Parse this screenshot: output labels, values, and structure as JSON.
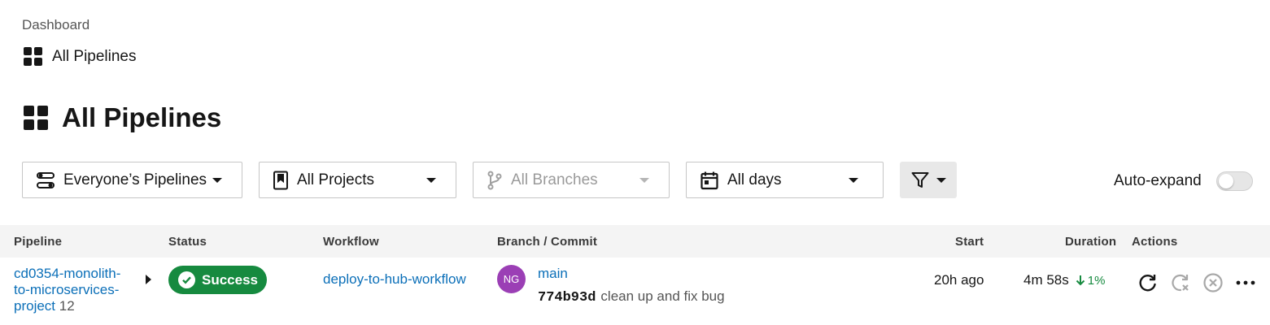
{
  "breadcrumb": {
    "parent": "Dashboard",
    "current": "All Pipelines"
  },
  "page": {
    "title": "All Pipelines"
  },
  "filters": {
    "pipelines": "Everyone’s Pipelines",
    "projects": "All Projects",
    "branches": "All Branches",
    "days": "All days"
  },
  "auto_expand": {
    "label": "Auto-expand",
    "enabled": false
  },
  "table": {
    "columns": {
      "pipeline": "Pipeline",
      "status": "Status",
      "workflow": "Workflow",
      "branch_commit": "Branch / Commit",
      "start": "Start",
      "duration": "Duration",
      "actions": "Actions"
    },
    "rows": [
      {
        "pipeline_name": "cd0354-monolith-to-microservices-project",
        "pipeline_number": "12",
        "status": "Success",
        "workflow": "deploy-to-hub-workflow",
        "avatar_initials": "NG",
        "branch": "main",
        "commit_sha": "774b93d",
        "commit_message": "clean up and fix bug",
        "start": "20h ago",
        "duration": "4m 58s",
        "duration_trend": "1%"
      }
    ]
  },
  "colors": {
    "link": "#0b6fb8",
    "success": "#168a3f",
    "avatar": "#9b3fb5"
  },
  "icons": [
    "grid-icon",
    "pipelines-icon",
    "bookmark-icon",
    "branch-icon",
    "calendar-icon",
    "funnel-icon",
    "check-icon",
    "arrow-down-icon",
    "rerun-icon",
    "rerun-failed-icon",
    "cancel-icon",
    "more-icon"
  ]
}
